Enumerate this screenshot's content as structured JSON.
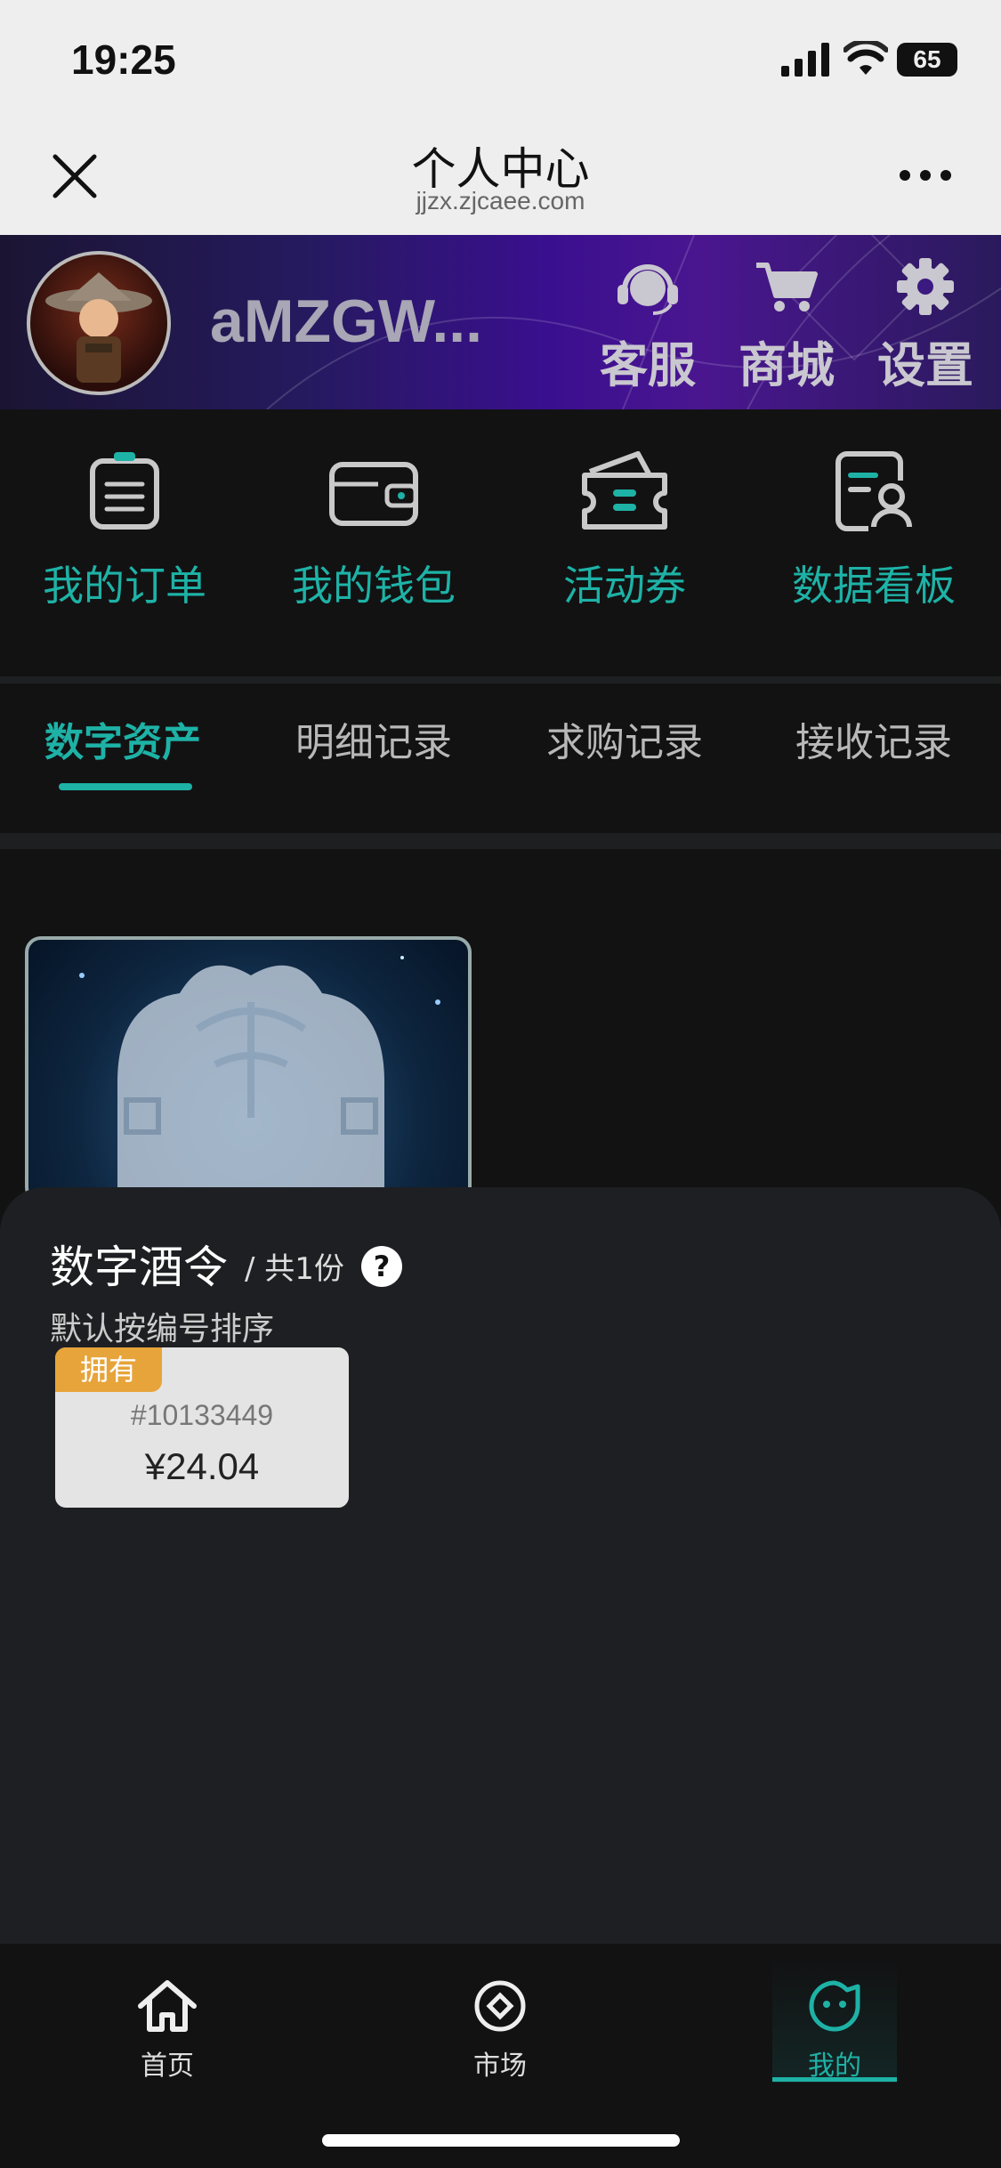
{
  "status": {
    "time": "19:25",
    "battery": "65"
  },
  "nav": {
    "title": "个人中心",
    "url": "jjzx.zjcaee.com"
  },
  "profile": {
    "username": "aMZGW...",
    "actions": [
      {
        "label": "客服",
        "icon": "headset-icon"
      },
      {
        "label": "商城",
        "icon": "cart-icon"
      },
      {
        "label": "设置",
        "icon": "gear-icon"
      }
    ]
  },
  "quick_menu": [
    {
      "label": "我的订单",
      "icon": "clipboard-icon"
    },
    {
      "label": "我的钱包",
      "icon": "wallet-icon"
    },
    {
      "label": "活动券",
      "icon": "coupon-icon"
    },
    {
      "label": "数据看板",
      "icon": "dashboard-icon"
    }
  ],
  "tabs": [
    "数字资产",
    "明细记录",
    "求购记录",
    "接收记录"
  ],
  "sheet": {
    "title": "数字酒令",
    "count": "/ 共1份",
    "help": "?",
    "sort": "默认按编号排序",
    "token": {
      "badge": "拥有",
      "number": "#10133449",
      "price": "¥24.04"
    }
  },
  "bottom_nav": [
    {
      "label": "首页",
      "icon": "home-icon"
    },
    {
      "label": "市场",
      "icon": "market-icon"
    },
    {
      "label": "我的",
      "icon": "profile-face-icon"
    }
  ],
  "colors": {
    "accent": "#1eb2a6",
    "badge": "#e7a43a"
  }
}
